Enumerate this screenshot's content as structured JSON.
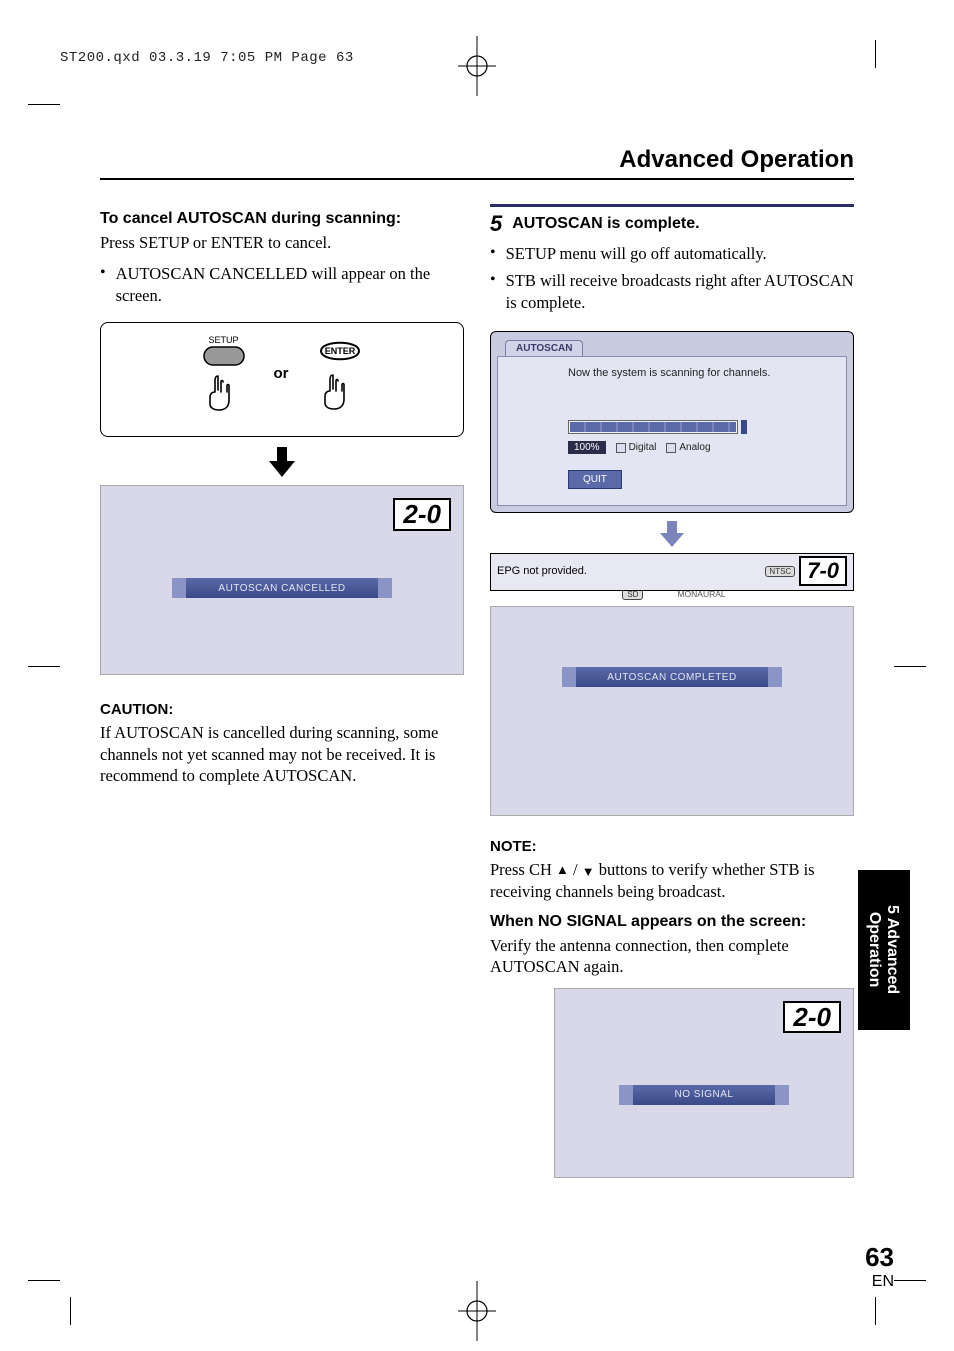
{
  "print": {
    "header": "ST200.qxd  03.3.19 7:05 PM  Page 63"
  },
  "header": {
    "title": "Advanced Operation"
  },
  "left": {
    "heading1": "To cancel AUTOSCAN during scanning:",
    "line1": "Press SETUP or ENTER to cancel.",
    "bullet1": "AUTOSCAN CANCELLED will appear on the screen.",
    "setup_label": "SETUP",
    "enter_label": "ENTER",
    "or_label": "or",
    "ch_cancel": "2-0",
    "banner_cancel": "AUTOSCAN CANCELLED",
    "caution_head": "CAUTION:",
    "caution_text": "If AUTOSCAN is cancelled during scanning, some channels not yet scanned may not be received. It is recommend to complete AUTOSCAN."
  },
  "right": {
    "step_num": "5",
    "step_title": "AUTOSCAN is complete.",
    "bullet1": "SETUP menu will go off automatically.",
    "bullet2": "STB will receive broadcasts right after AUTOSCAN is complete.",
    "dialog": {
      "tab": "AUTOSCAN",
      "message": "Now the system is scanning for channels.",
      "percent": "100%",
      "legend_digital": "Digital",
      "legend_analog": "Analog",
      "quit": "QUIT"
    },
    "epg": {
      "text": "EPG not provided.",
      "badge_ntsc": "NTSC",
      "badge_sd": "SD",
      "badge_mono": "MONAURAL",
      "ch": "7-0"
    },
    "banner_complete": "AUTOSCAN COMPLETED",
    "note_head": "NOTE:",
    "note_text_pre": "Press CH ",
    "note_text_post": " buttons to verify whether STB is receiving channels being broadcast.",
    "nosignal_head": "When NO SIGNAL appears on the screen:",
    "nosignal_text": "Verify the antenna connection, then complete AUTOSCAN again.",
    "ch_nosig": "2-0",
    "banner_nosig": "NO SIGNAL"
  },
  "sidetab": {
    "line1": "5 Advanced",
    "line2": "Operation"
  },
  "footer": {
    "page": "63",
    "lang": "EN"
  }
}
